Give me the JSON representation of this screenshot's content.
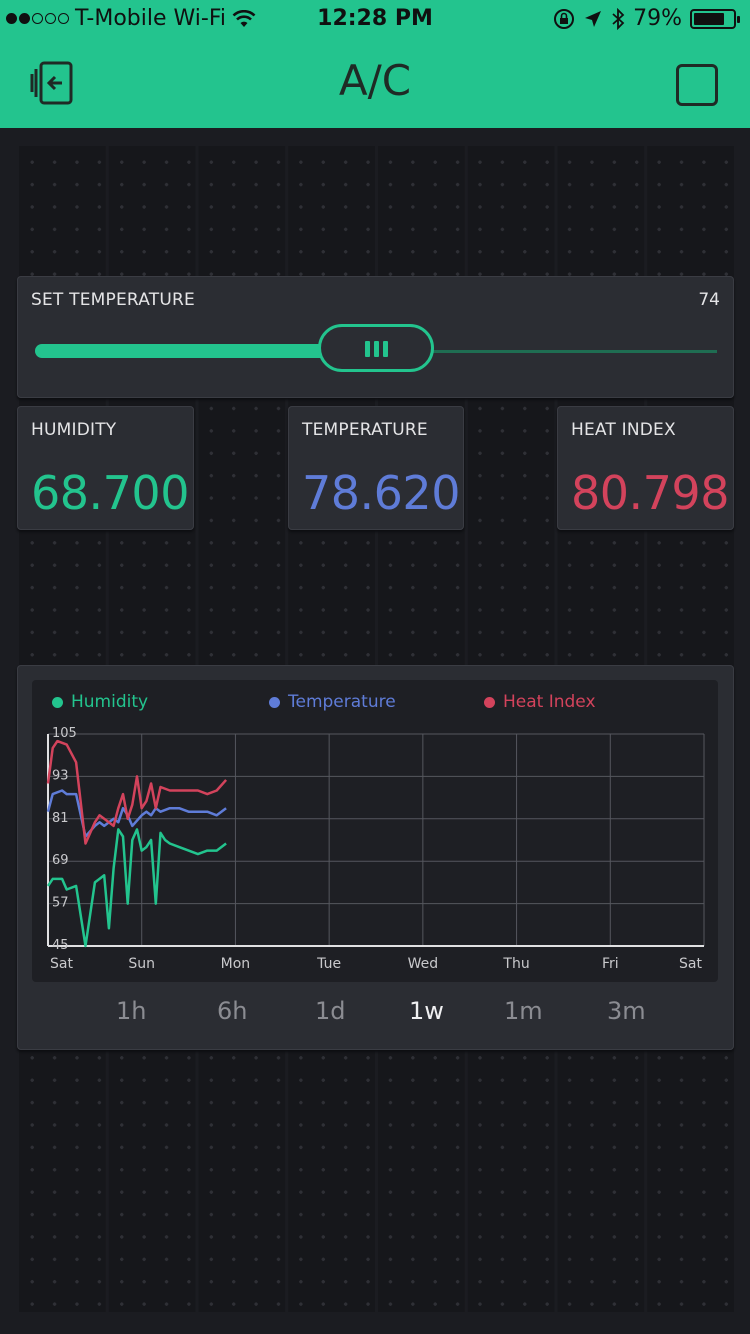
{
  "status_bar": {
    "carrier": "T-Mobile Wi-Fi",
    "time": "12:28 PM",
    "battery": "79%",
    "battery_level": 0.79,
    "signal_bars_filled": 2
  },
  "header": {
    "title": "A/C"
  },
  "set_temperature": {
    "label": "SET TEMPERATURE",
    "value": "74",
    "fraction": 0.5
  },
  "tiles": [
    {
      "label": "HUMIDITY",
      "value": "68.700",
      "color": "#23c48e"
    },
    {
      "label": "TEMPERATURE",
      "value": "78.620",
      "color": "#5f7cd8"
    },
    {
      "label": "HEAT INDEX",
      "value": "80.798",
      "color": "#d3435c"
    }
  ],
  "chart": {
    "legend": [
      {
        "name": "Humidity",
        "color": "#23c48e"
      },
      {
        "name": "Temperature",
        "color": "#5f7cd8"
      },
      {
        "name": "Heat Index",
        "color": "#d3435c"
      }
    ],
    "ranges": [
      "1h",
      "6h",
      "1d",
      "1w",
      "1m",
      "3m"
    ],
    "active_range": "1w"
  },
  "chart_data": {
    "type": "line",
    "x_ticks": [
      "Sat",
      "Sun",
      "Mon",
      "Tue",
      "Wed",
      "Thu",
      "Fri",
      "Sat"
    ],
    "y_ticks": [
      105,
      93,
      81,
      69,
      57,
      45
    ],
    "ylim": [
      45,
      105
    ],
    "xlim": [
      0,
      7
    ],
    "grid": true,
    "legend_position": "top",
    "series": [
      {
        "name": "Humidity",
        "color": "#23c48e",
        "x": [
          0,
          0.05,
          0.15,
          0.2,
          0.3,
          0.4,
          0.5,
          0.55,
          0.6,
          0.65,
          0.7,
          0.75,
          0.8,
          0.85,
          0.9,
          0.95,
          1.0,
          1.05,
          1.1,
          1.15,
          1.2,
          1.25,
          1.3,
          1.4,
          1.5,
          1.6,
          1.7,
          1.8,
          1.9
        ],
        "y": [
          62,
          64,
          64,
          61,
          62,
          45,
          63,
          64,
          65,
          50,
          67,
          78,
          76,
          57,
          75,
          78,
          72,
          73,
          75,
          57,
          77,
          75,
          74,
          73,
          72,
          71,
          72,
          72,
          74
        ]
      },
      {
        "name": "Temperature",
        "color": "#5f7cd8",
        "x": [
          0,
          0.05,
          0.15,
          0.2,
          0.3,
          0.4,
          0.5,
          0.55,
          0.6,
          0.7,
          0.75,
          0.8,
          0.85,
          0.9,
          1.0,
          1.05,
          1.1,
          1.15,
          1.2,
          1.3,
          1.4,
          1.5,
          1.6,
          1.7,
          1.8,
          1.9
        ],
        "y": [
          83,
          88,
          89,
          88,
          88,
          76,
          79,
          80,
          79,
          81,
          80,
          84,
          82,
          79,
          82,
          83,
          82,
          84,
          83,
          84,
          84,
          83,
          83,
          83,
          82,
          84
        ]
      },
      {
        "name": "Heat Index",
        "color": "#d3435c",
        "x": [
          0,
          0.05,
          0.1,
          0.2,
          0.3,
          0.4,
          0.5,
          0.55,
          0.6,
          0.7,
          0.75,
          0.8,
          0.85,
          0.9,
          0.95,
          1.0,
          1.05,
          1.1,
          1.15,
          1.2,
          1.3,
          1.4,
          1.5,
          1.6,
          1.7,
          1.8,
          1.9
        ],
        "y": [
          91,
          101,
          103,
          102,
          97,
          74,
          80,
          82,
          81,
          79,
          84,
          88,
          81,
          85,
          93,
          84,
          86,
          91,
          84,
          90,
          89,
          89,
          89,
          89,
          88,
          89,
          92
        ]
      }
    ]
  }
}
